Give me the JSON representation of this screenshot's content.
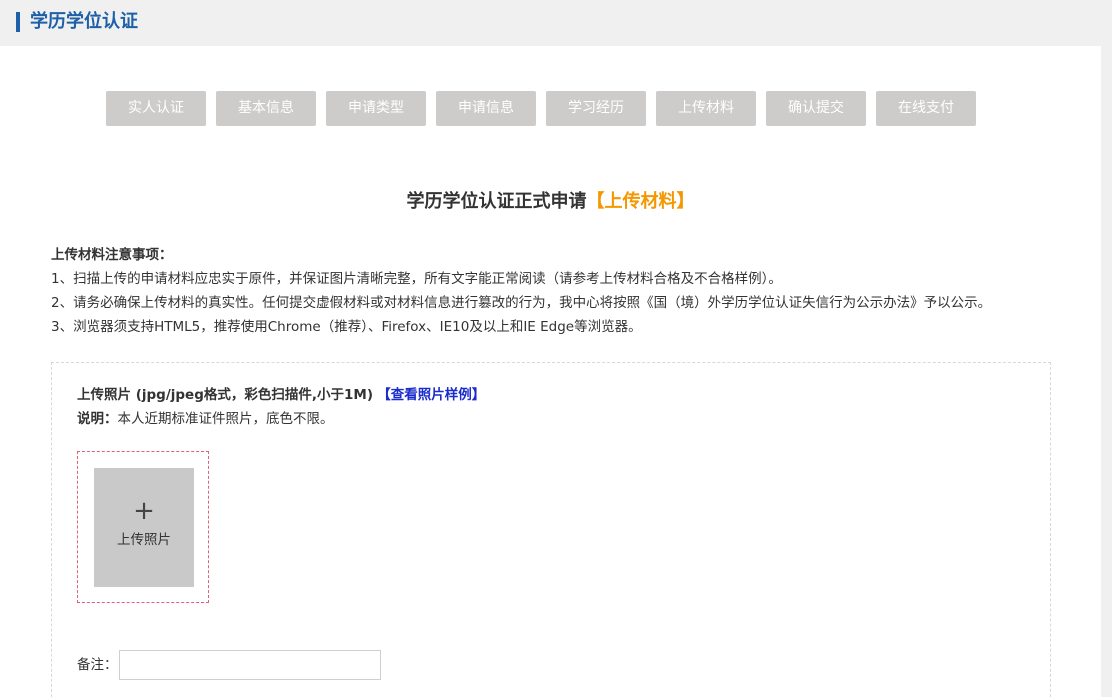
{
  "header": {
    "title": "学历学位认证"
  },
  "steps": [
    {
      "label": "实人认证"
    },
    {
      "label": "基本信息"
    },
    {
      "label": "申请类型"
    },
    {
      "label": "申请信息"
    },
    {
      "label": "学习经历"
    },
    {
      "label": "上传材料"
    },
    {
      "label": "确认提交"
    },
    {
      "label": "在线支付"
    }
  ],
  "heading": {
    "main": "学历学位认证正式申请",
    "highlight": "【上传材料】"
  },
  "notes": {
    "title": "上传材料注意事项：",
    "items": [
      "1、扫描上传的申请材料应忠实于原件，并保证图片清晰完整，所有文字能正常阅读（请参考上传材料合格及不合格样例）。",
      "2、请务必确保上传材料的真实性。任何提交虚假材料或对材料信息进行篡改的行为，我中心将按照《国（境）外学历学位认证失信行为公示办法》予以公示。",
      "3、浏览器须支持HTML5，推荐使用Chrome（推荐）、Firefox、IE10及以上和IE Edge等浏览器。"
    ]
  },
  "upload": {
    "label": "上传照片 (jpg/jpeg格式，彩色扫描件,小于1M)",
    "sample_link": "【查看照片样例】",
    "desc_key": "说明：",
    "desc_text": "本人近期标准证件照片，底色不限。",
    "plus": "+",
    "button_text": "上传照片"
  },
  "remark": {
    "label": "备注：",
    "value": "",
    "placeholder": ""
  },
  "colors": {
    "accent": "#1d5fa8",
    "highlight": "#f39800",
    "link": "#1a2ccc",
    "step_bg": "#cecbcb"
  }
}
